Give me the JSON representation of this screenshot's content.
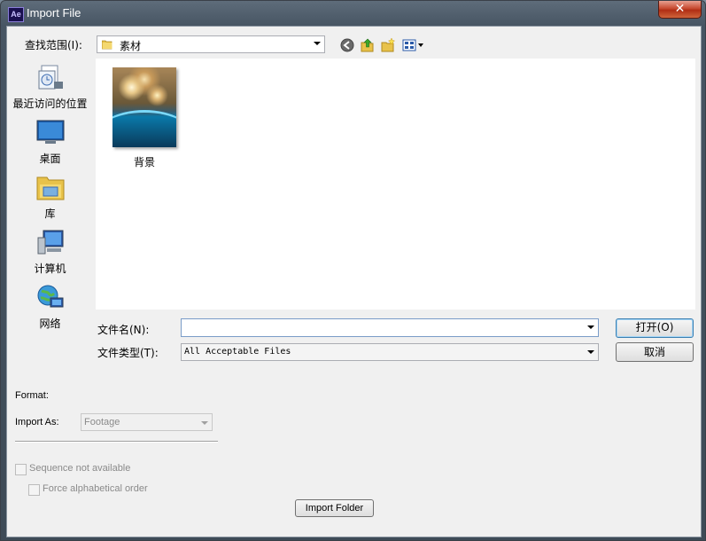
{
  "window": {
    "title": "Import File",
    "app_icon_text": "Ae",
    "close_symbol": "✕"
  },
  "toolbar": {
    "look_in_label": "查找范围(I):",
    "look_in_value": "素材",
    "icons": [
      "back-icon",
      "up-folder-icon",
      "new-folder-icon",
      "view-menu-icon"
    ]
  },
  "sidebar": {
    "items": [
      {
        "label": "最近访问的位置",
        "icon": "recent-places-icon"
      },
      {
        "label": "桌面",
        "icon": "desktop-icon"
      },
      {
        "label": "库",
        "icon": "libraries-icon"
      },
      {
        "label": "计算机",
        "icon": "computer-icon"
      },
      {
        "label": "网络",
        "icon": "network-icon"
      }
    ]
  },
  "files": [
    {
      "name": "背景"
    }
  ],
  "form": {
    "file_name_label": "文件名(N):",
    "file_name_value": "",
    "file_type_label": "文件类型(T):",
    "file_type_value": "All Acceptable Files",
    "open_label": "打开(O)",
    "cancel_label": "取消"
  },
  "ae_options": {
    "format_label": "Format:",
    "import_as_label": "Import As:",
    "import_as_value": "Footage",
    "sequence_label": "Sequence not available",
    "force_alpha_label": "Force alphabetical order",
    "import_folder_label": "Import Folder"
  },
  "colors": {
    "title_bar": "#475563",
    "close_button": "#c74a30",
    "dialog_bg": "#f0f0f0"
  }
}
